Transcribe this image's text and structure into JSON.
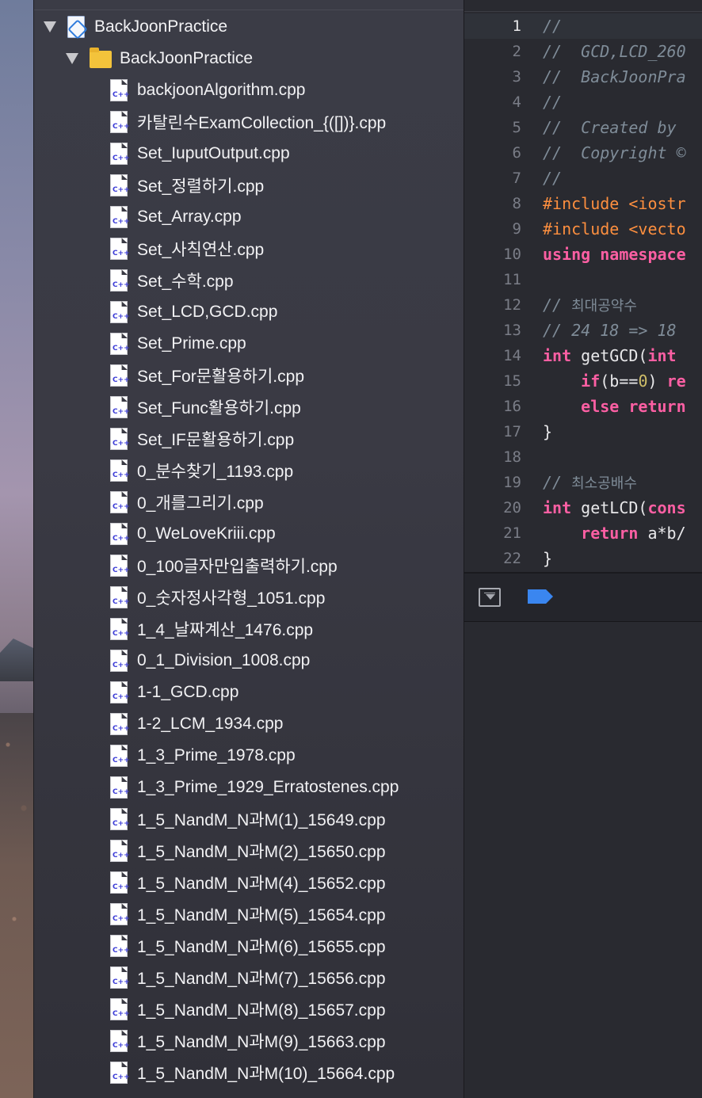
{
  "navigator": {
    "project": {
      "name": "BackJoonPractice"
    },
    "group": {
      "name": "BackJoonPractice"
    },
    "file_badge": "C++",
    "files": [
      "backjoonAlgorithm.cpp",
      "카탈린수ExamCollection_{([])}.cpp",
      "Set_IuputOutput.cpp",
      "Set_정렬하기.cpp",
      "Set_Array.cpp",
      "Set_사칙연산.cpp",
      "Set_수학.cpp",
      "Set_LCD,GCD.cpp",
      "Set_Prime.cpp",
      "Set_For문활용하기.cpp",
      "Set_Func활용하기.cpp",
      "Set_IF문활용하기.cpp",
      "0_분수찾기_1193.cpp",
      "0_개를그리기.cpp",
      "0_WeLoveKriii.cpp",
      "0_100글자만입출력하기.cpp",
      "0_숫자정사각형_1051.cpp",
      "1_4_날짜계산_1476.cpp",
      "0_1_Division_1008.cpp",
      "1-1_GCD.cpp",
      "1-2_LCM_1934.cpp",
      "1_3_Prime_1978.cpp",
      "1_3_Prime_1929_Erratostenes.cpp",
      "1_5_NandM_N과M(1)_15649.cpp",
      "1_5_NandM_N과M(2)_15650.cpp",
      "1_5_NandM_N과M(4)_15652.cpp",
      "1_5_NandM_N과M(5)_15654.cpp",
      "1_5_NandM_N과M(6)_15655.cpp",
      "1_5_NandM_N과M(7)_15656.cpp",
      "1_5_NandM_N과M(8)_15657.cpp",
      "1_5_NandM_N과M(9)_15663.cpp",
      "1_5_NandM_N과M(10)_15664.cpp"
    ]
  },
  "editor": {
    "current_line": 1,
    "lines": [
      {
        "n": "1",
        "tokens": [
          {
            "t": "//",
            "c": "comment"
          }
        ]
      },
      {
        "n": "2",
        "tokens": [
          {
            "t": "//  GCD,LCD_260",
            "c": "comment"
          }
        ]
      },
      {
        "n": "3",
        "tokens": [
          {
            "t": "//  BackJoonPra",
            "c": "comment"
          }
        ]
      },
      {
        "n": "4",
        "tokens": [
          {
            "t": "//",
            "c": "comment"
          }
        ]
      },
      {
        "n": "5",
        "tokens": [
          {
            "t": "//  Created by ",
            "c": "comment"
          }
        ]
      },
      {
        "n": "6",
        "tokens": [
          {
            "t": "//  Copyright ©",
            "c": "comment"
          }
        ]
      },
      {
        "n": "7",
        "tokens": [
          {
            "t": "//",
            "c": "comment"
          }
        ]
      },
      {
        "n": "8",
        "tokens": [
          {
            "t": "#include <iostr",
            "c": "prep"
          }
        ]
      },
      {
        "n": "9",
        "tokens": [
          {
            "t": "#include <vecto",
            "c": "prep"
          }
        ]
      },
      {
        "n": "10",
        "tokens": [
          {
            "t": "using namespace",
            "c": "kw"
          }
        ]
      },
      {
        "n": "11",
        "tokens": []
      },
      {
        "n": "12",
        "tokens": [
          {
            "t": "// ",
            "c": "comment"
          },
          {
            "t": "최대공약수",
            "c": "comment-ko"
          }
        ]
      },
      {
        "n": "13",
        "tokens": [
          {
            "t": "// 24 18 => 18 ",
            "c": "comment"
          }
        ]
      },
      {
        "n": "14",
        "tokens": [
          {
            "t": "int",
            "c": "kw"
          },
          {
            "t": " getGCD(",
            "c": "plain"
          },
          {
            "t": "int",
            "c": "kw"
          }
        ]
      },
      {
        "n": "15",
        "tokens": [
          {
            "t": "    ",
            "c": "plain"
          },
          {
            "t": "if",
            "c": "kw"
          },
          {
            "t": "(b==",
            "c": "plain"
          },
          {
            "t": "0",
            "c": "num"
          },
          {
            "t": ") ",
            "c": "plain"
          },
          {
            "t": "re",
            "c": "kw"
          }
        ]
      },
      {
        "n": "16",
        "tokens": [
          {
            "t": "    ",
            "c": "plain"
          },
          {
            "t": "else return",
            "c": "kw"
          }
        ]
      },
      {
        "n": "17",
        "tokens": [
          {
            "t": "}",
            "c": "plain"
          }
        ]
      },
      {
        "n": "18",
        "tokens": []
      },
      {
        "n": "19",
        "tokens": [
          {
            "t": "// ",
            "c": "comment"
          },
          {
            "t": "최소공배수",
            "c": "comment-ko"
          }
        ]
      },
      {
        "n": "20",
        "tokens": [
          {
            "t": "int",
            "c": "kw"
          },
          {
            "t": " getLCD(",
            "c": "plain"
          },
          {
            "t": "cons",
            "c": "kw"
          }
        ]
      },
      {
        "n": "21",
        "tokens": [
          {
            "t": "    ",
            "c": "plain"
          },
          {
            "t": "return",
            "c": "kw"
          },
          {
            "t": " a*b/",
            "c": "plain"
          }
        ]
      },
      {
        "n": "22",
        "tokens": [
          {
            "t": "}",
            "c": "plain"
          }
        ]
      }
    ]
  },
  "debug_bar": {
    "hide_debug_icon": "hide-debug-area-icon",
    "breakpoints_icon": "breakpoint-toggle-icon",
    "breakpoint_color": "#3a86f0"
  },
  "colors": {
    "sidebar_bg": "#3a3a44",
    "editor_bg": "#292a30",
    "comment": "#7f8c98",
    "preprocessor": "#fd8f3f",
    "keyword": "#fc5fa3",
    "number": "#d0bf69",
    "folder": "#f3c33b"
  }
}
